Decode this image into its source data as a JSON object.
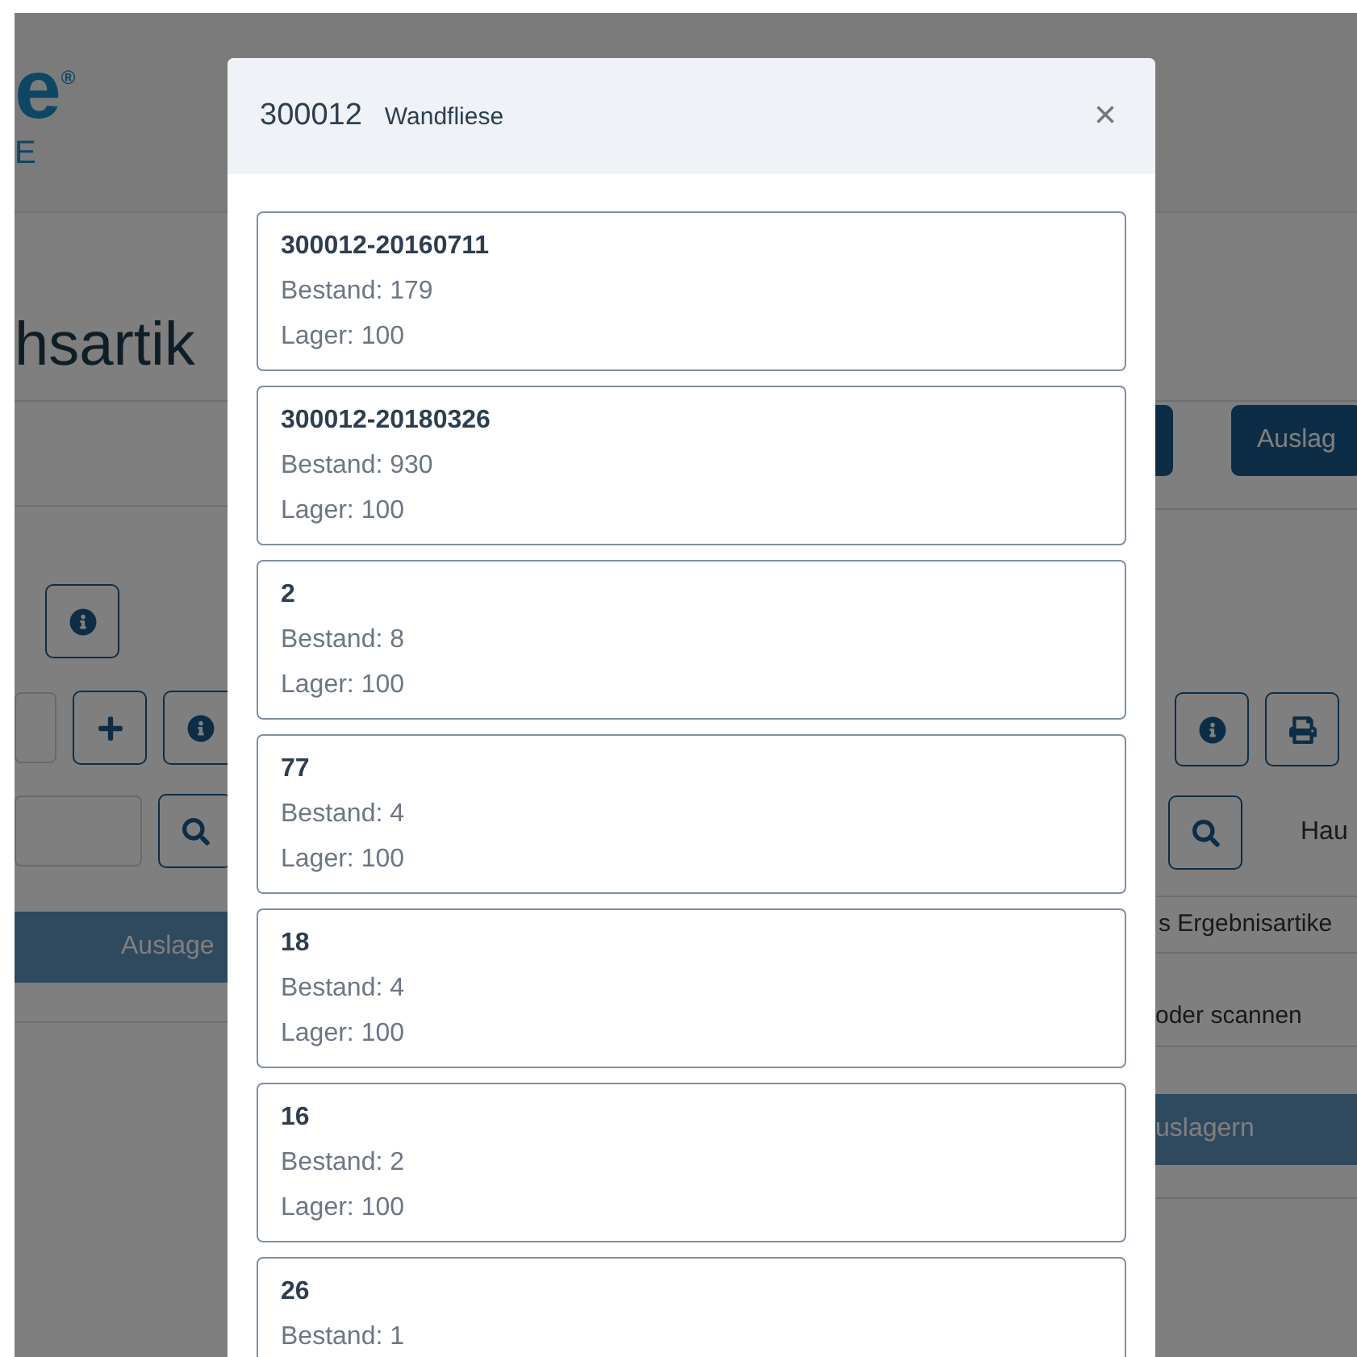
{
  "background": {
    "logo": {
      "mark": "e$^{®}$",
      "sub": "E"
    },
    "heading": "hsartik",
    "action_button": "Auslag",
    "left_bar": "Auslage",
    "right_search_label": "Hau",
    "result_label": "s Ergebnisartike",
    "scan_hint": "oder scannen",
    "right_bar": "uslagern"
  },
  "modal": {
    "code": "300012",
    "title": "Wandfliese",
    "close": "×",
    "batches": [
      {
        "id": "300012-20160711",
        "lines": [
          "Bestand: 179",
          "Lager: 100"
        ]
      },
      {
        "id": "300012-20180326",
        "lines": [
          "Bestand: 930",
          "Lager: 100"
        ]
      },
      {
        "id": "2",
        "lines": [
          "Bestand: 8",
          "Lager: 100"
        ]
      },
      {
        "id": "77",
        "lines": [
          "Bestand: 4",
          "Lager: 100"
        ]
      },
      {
        "id": "18",
        "lines": [
          "Bestand: 4",
          "Lager: 100"
        ]
      },
      {
        "id": "16",
        "lines": [
          "Bestand: 2",
          "Lager: 100"
        ]
      },
      {
        "id": "26",
        "lines": [
          "Bestand: 1"
        ]
      }
    ]
  }
}
